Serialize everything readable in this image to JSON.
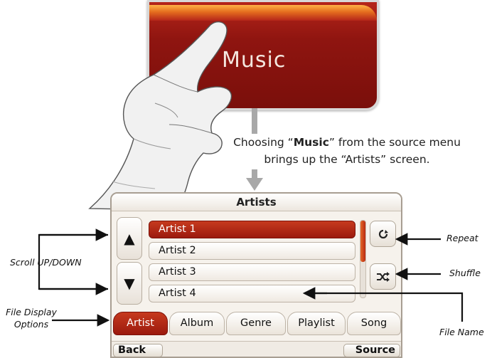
{
  "source_tile": {
    "label": "Music"
  },
  "caption": {
    "part1": "Choosing “",
    "bold": "Music",
    "part2": "” from the source menu brings up the “Artists” screen."
  },
  "screen": {
    "title": "Artists",
    "list_items": [
      {
        "label": "Artist 1",
        "selected": true
      },
      {
        "label": "Artist 2",
        "selected": false
      },
      {
        "label": "Artist 3",
        "selected": false
      },
      {
        "label": "Artist 4",
        "selected": false
      }
    ],
    "scroll_up_glyph": "▲",
    "scroll_down_glyph": "▼",
    "repeat_icon": "repeat-icon",
    "shuffle_icon": "shuffle-icon",
    "tabs": [
      {
        "label": "Artist",
        "active": true
      },
      {
        "label": "Album",
        "active": false
      },
      {
        "label": "Genre",
        "active": false
      },
      {
        "label": "Playlist",
        "active": false
      },
      {
        "label": "Song",
        "active": false
      }
    ],
    "back_label": "Back",
    "source_label": "Source",
    "accent_color": "#9c1a0e"
  },
  "callouts": {
    "scroll": "Scroll UP/DOWN",
    "file_display_line1": "File Display",
    "file_display_line2": "Options",
    "repeat": "Repeat",
    "shuffle": "Shuffle",
    "file_name": "File Name"
  }
}
